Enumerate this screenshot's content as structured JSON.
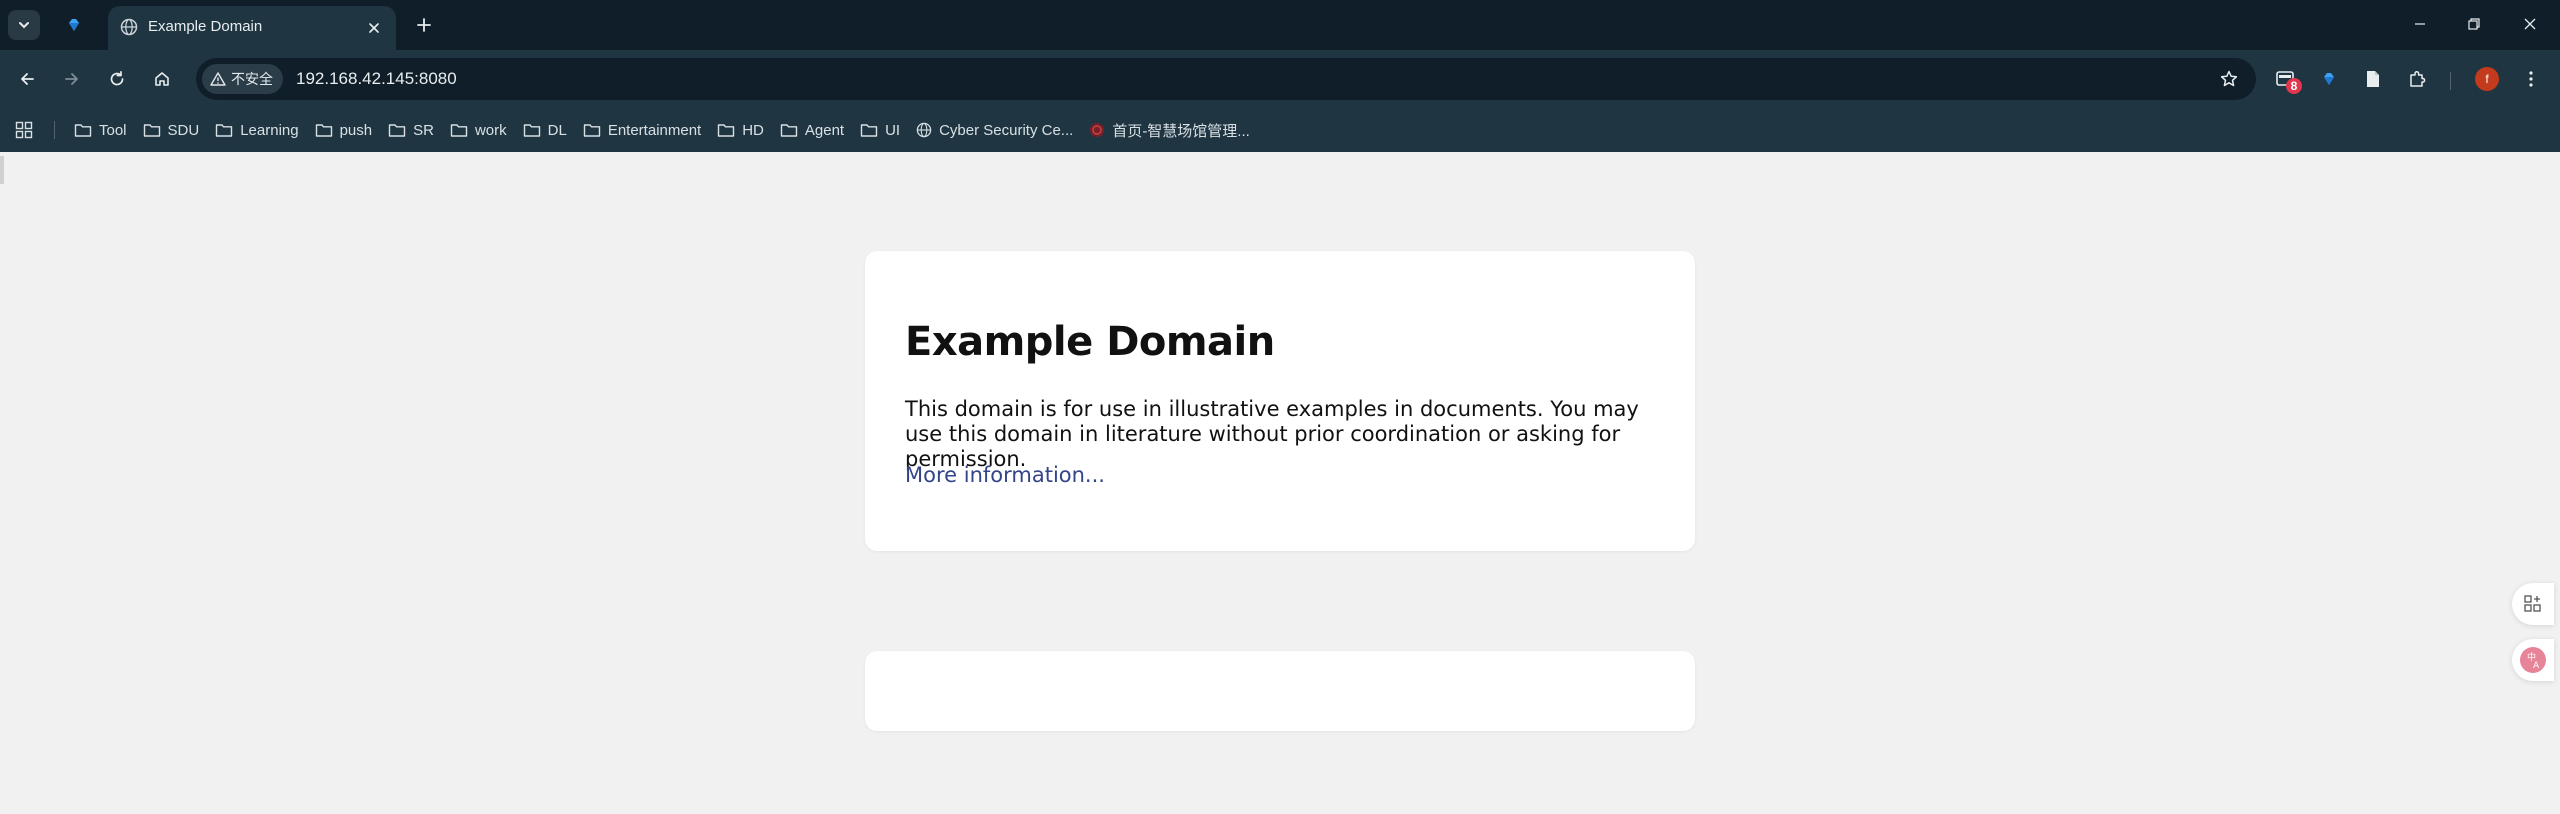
{
  "tab": {
    "title": "Example Domain",
    "close_icon": "close-icon"
  },
  "toolbar": {
    "security_label": "不安全",
    "url": "192.168.42.145:8080",
    "extension_badge": "8",
    "profile_initial": "f"
  },
  "bookmarks": [
    {
      "label": "Tool",
      "icon": "folder-icon"
    },
    {
      "label": "SDU",
      "icon": "folder-icon"
    },
    {
      "label": "Learning",
      "icon": "folder-icon"
    },
    {
      "label": "push",
      "icon": "folder-icon"
    },
    {
      "label": "SR",
      "icon": "folder-icon"
    },
    {
      "label": "work",
      "icon": "folder-icon"
    },
    {
      "label": "DL",
      "icon": "folder-icon"
    },
    {
      "label": "Entertainment",
      "icon": "folder-icon"
    },
    {
      "label": "HD",
      "icon": "folder-icon"
    },
    {
      "label": "Agent",
      "icon": "folder-icon"
    },
    {
      "label": "UI",
      "icon": "folder-icon"
    },
    {
      "label": "Cyber Security Ce...",
      "icon": "globe-icon"
    },
    {
      "label": "首页-智慧场馆管理...",
      "icon": "site-logo-icon"
    }
  ],
  "page": {
    "heading": "Example Domain",
    "body": "This domain is for use in illustrative examples in documents. You may use this domain in literature without prior coordination or asking for permission.",
    "link": "More information..."
  },
  "colors": {
    "tabstrip_bg": "#0f1e28",
    "toolbar_bg": "#1f3541",
    "page_bg": "#f1f1f2",
    "link": "#334488",
    "badge": "#e2364c",
    "avatar": "#c43a1c"
  }
}
